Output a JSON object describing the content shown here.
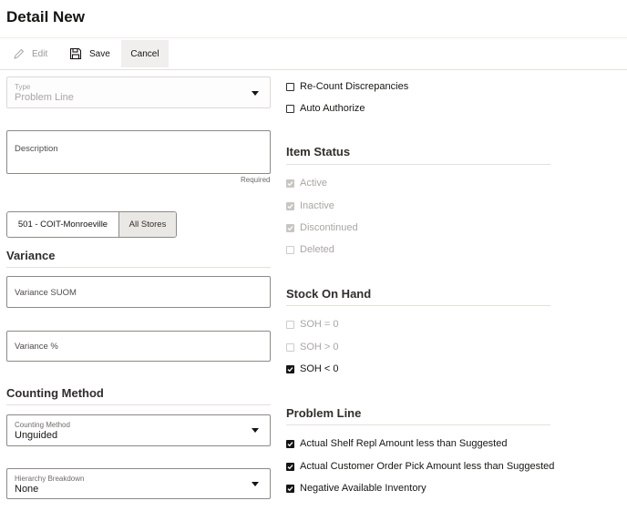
{
  "page": {
    "title": "Detail New"
  },
  "toolbar": {
    "edit_label": "Edit",
    "save_label": "Save",
    "cancel_label": "Cancel"
  },
  "type_field": {
    "label": "Type",
    "value": "Problem Line"
  },
  "description_field": {
    "placeholder": "Description",
    "required_text": "Required"
  },
  "store_selector": {
    "store_label": "501 - COIT-Monroeville",
    "all_stores_label": "All Stores"
  },
  "variance": {
    "title": "Variance",
    "suom_placeholder": "Variance SUOM",
    "percent_placeholder": "Variance %"
  },
  "counting_method": {
    "title": "Counting Method",
    "method_label": "Counting Method",
    "method_value": "Unguided",
    "hierarchy_label": "Hierarchy Breakdown",
    "hierarchy_value": "None"
  },
  "options": {
    "recount_label": "Re-Count Discrepancies",
    "auto_authorize_label": "Auto Authorize"
  },
  "item_status": {
    "title": "Item Status",
    "items": [
      {
        "label": "Active",
        "checked": true
      },
      {
        "label": "Inactive",
        "checked": true
      },
      {
        "label": "Discontinued",
        "checked": true
      },
      {
        "label": "Deleted",
        "checked": false
      }
    ]
  },
  "stock_on_hand": {
    "title": "Stock On Hand",
    "items": [
      {
        "label": "SOH = 0",
        "checked": false
      },
      {
        "label": "SOH > 0",
        "checked": false
      },
      {
        "label": "SOH < 0",
        "checked": true
      }
    ]
  },
  "problem_line": {
    "title": "Problem Line",
    "items": [
      {
        "label": "Actual Shelf Repl Amount less than Suggested",
        "checked": true
      },
      {
        "label": "Actual Customer Order Pick Amount less than Suggested",
        "checked": true
      },
      {
        "label": "Negative Available Inventory",
        "checked": true
      }
    ]
  }
}
